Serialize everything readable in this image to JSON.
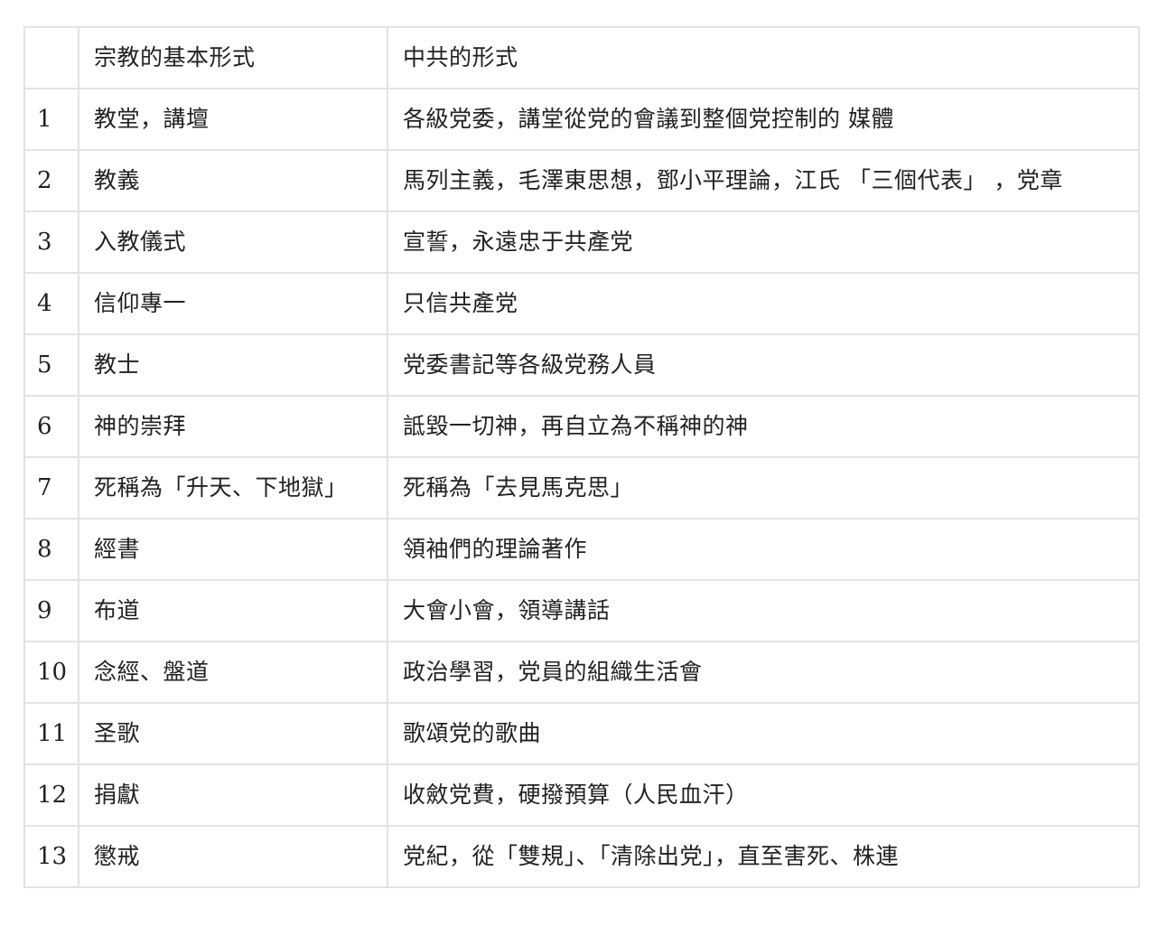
{
  "table": {
    "headers": [
      "",
      "宗教的基本形式",
      "中共的形式"
    ],
    "rows": [
      [
        "1",
        "教堂，講壇",
        "各級党委，講堂從党的會議到整個党控制的 媒體"
      ],
      [
        "2",
        "教義",
        "馬列主義，毛澤東思想，鄧小平理論，江氏 「三個代表」 ，党章"
      ],
      [
        "3",
        "入教儀式",
        "宣誓，永遠忠于共產党"
      ],
      [
        "4",
        "信仰專一",
        "只信共產党"
      ],
      [
        "5",
        "教士",
        "党委書記等各級党務人員"
      ],
      [
        "6",
        "神的崇拜",
        "詆毀一切神，再自立為不稱神的神"
      ],
      [
        "7",
        "死稱為「升天、下地獄」",
        "死稱為「去見馬克思」"
      ],
      [
        "8",
        "經書",
        "領袖們的理論著作"
      ],
      [
        "9",
        "布道",
        "大會小會，領導講話"
      ],
      [
        "10",
        "念經、盤道",
        "政治學習，党員的組織生活會"
      ],
      [
        "11",
        "圣歌",
        "歌頌党的歌曲"
      ],
      [
        "12",
        "捐獻",
        "收斂党費，硬撥預算（人民血汗）"
      ],
      [
        "13",
        "懲戒",
        "党紀，從「雙規」、「清除出党」，直至害死、株連"
      ]
    ]
  }
}
